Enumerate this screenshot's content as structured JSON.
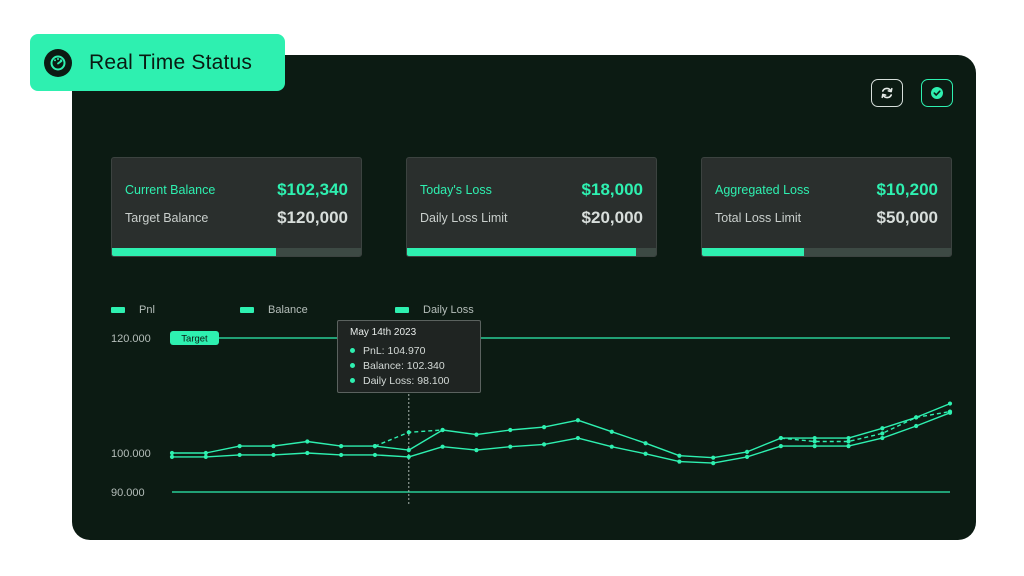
{
  "header": {
    "title": "Real Time Status",
    "icon": "gauge-icon"
  },
  "toolbar": {
    "refresh_icon": "refresh-icon",
    "confirm_icon": "check-circle-icon"
  },
  "colors": {
    "accent": "#2ef0b0",
    "panel_bg": "#0c1b13",
    "card_bg": "#2a2f2d"
  },
  "cards": [
    {
      "primary_label": "Current Balance",
      "primary_value": "$102,340",
      "secondary_label": "Target Balance",
      "secondary_value": "$120,000",
      "progress": 0.66
    },
    {
      "primary_label": "Today's Loss",
      "primary_value": "$18,000",
      "secondary_label": "Daily Loss Limit",
      "secondary_value": "$20,000",
      "progress": 0.92
    },
    {
      "primary_label": "Aggregated Loss",
      "primary_value": "$10,200",
      "secondary_label": "Total Loss Limit",
      "secondary_value": "$50,000",
      "progress": 0.41
    }
  ],
  "legend": {
    "pnl": "Pnl",
    "balance": "Balance",
    "daily_loss": "Daily Loss"
  },
  "tooltip": {
    "date": "May 14th 2023",
    "pnl": "PnL: 104.970",
    "balance": "Balance: 102.340",
    "daily_loss": "Daily Loss: 98.100"
  },
  "chart_data": {
    "type": "line",
    "target_label": "Target",
    "target_value": 120000,
    "floor_value": 90000,
    "y_ticks": [
      {
        "value": 120000,
        "label": "120.000"
      },
      {
        "value": 100000,
        "label": "100.000"
      },
      {
        "value": 90000,
        "label": "90.000"
      }
    ],
    "ylim": [
      90000,
      120000
    ],
    "hover_index": 7,
    "series": [
      {
        "name": "Balance",
        "style": "solid",
        "values": [
          100000,
          100000,
          101200,
          101200,
          102000,
          101200,
          101200,
          100500,
          104000,
          103200,
          104000,
          104500,
          105700,
          103700,
          101700,
          99300,
          98800,
          100200,
          102600,
          102600,
          102600,
          104300,
          106200,
          108600
        ]
      },
      {
        "name": "PnL",
        "style": "dashed",
        "values": [
          null,
          null,
          null,
          null,
          null,
          null,
          101200,
          103600,
          104000,
          null,
          null,
          null,
          null,
          null,
          null,
          null,
          null,
          null,
          102600,
          102000,
          102000,
          103400,
          106200,
          107200
        ]
      },
      {
        "name": "Daily Loss",
        "style": "solid",
        "values": [
          99000,
          99000,
          99500,
          99500,
          100000,
          99500,
          99500,
          99000,
          101100,
          100500,
          101100,
          101500,
          102600,
          101100,
          99800,
          97800,
          97400,
          99000,
          101200,
          101200,
          101200,
          102600,
          104700,
          107000
        ]
      }
    ]
  }
}
